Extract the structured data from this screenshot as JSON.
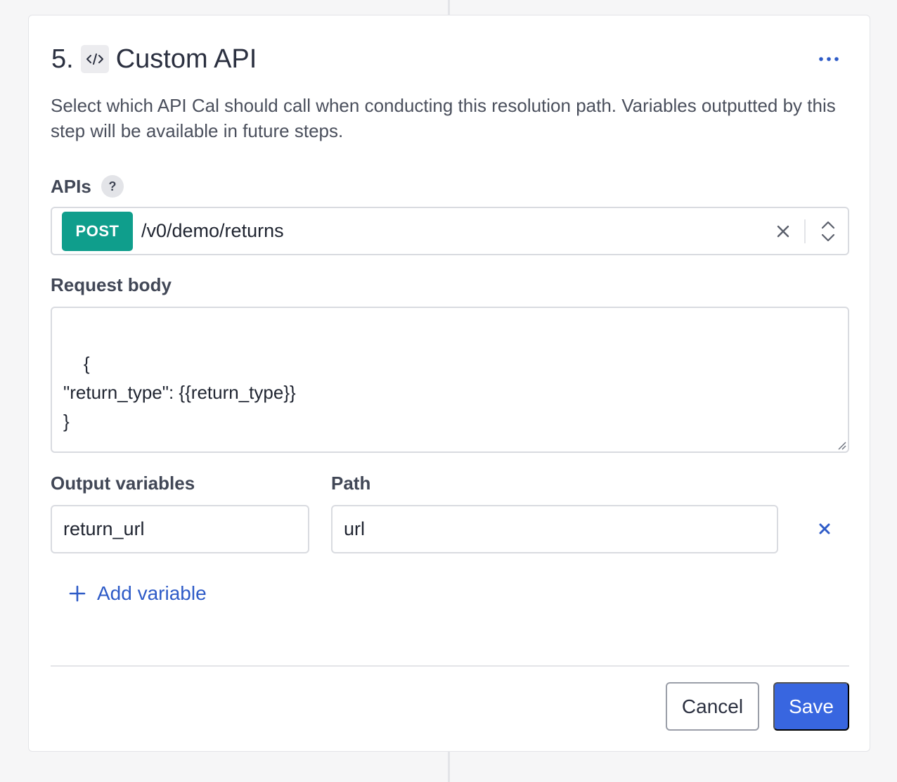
{
  "step": {
    "number": "5.",
    "title": "Custom API",
    "icon": "code-icon",
    "more_icon": "ellipsis-icon",
    "description": "Select which API Cal should call when conducting this resolution path. Variables outputted by this step will be available in future steps."
  },
  "apis": {
    "label": "APIs",
    "help_text": "?",
    "selected": {
      "method": "POST",
      "method_color": "#0f9e8c",
      "path": "/v0/demo/returns"
    }
  },
  "request_body": {
    "label": "Request body",
    "value": "{\n\"return_type\": {{return_type}}\n}"
  },
  "output_variables": {
    "label": "Output variables",
    "path_label": "Path",
    "rows": [
      {
        "name": "return_url",
        "path": "url"
      }
    ],
    "add_label": "Add variable"
  },
  "actions": {
    "cancel": "Cancel",
    "save": "Save",
    "save_color": "#3866e0"
  }
}
